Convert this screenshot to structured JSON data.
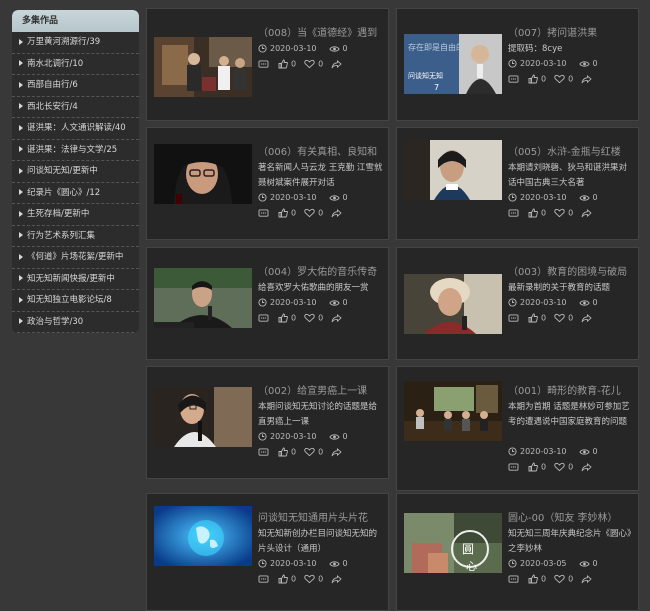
{
  "sidebar": {
    "title": "多集作品",
    "items": [
      "万里黄河溯源行/39",
      "南水北调行/10",
      "西部自由行/6",
      "西北长安行/4",
      "谌洪果：人文通识解读/40",
      "谌洪果：法律与文学/25",
      "问谈知无知/更新中",
      "纪录片《圆心》/12",
      "生死存档/更新中",
      "行为艺术系列汇集",
      "《何道》片场花絮/更新中",
      "知无知新闻快报/更新中",
      "知无知独立电影论坛/8",
      "政治与哲学/30"
    ]
  },
  "cards": [
    {
      "title": "（008）当《道德经》遇到",
      "desc": "",
      "date": "2020-03-10",
      "views": "0",
      "likes": "0",
      "favs": "0",
      "thumb": "thumb-bookstore"
    },
    {
      "title": "（007）拷问谌洪果",
      "desc": "提取码：8cye",
      "date": "2020-03-10",
      "views": "0",
      "likes": "0",
      "favs": "0",
      "thumb": "thumb-portrait-blue",
      "thumb_text1": "存在即是自由的",
      "thumb_text2": "问谈知无知",
      "thumb_text3": "7"
    },
    {
      "title": "（006）有关真相、良知和",
      "desc": "著名新闻人马云龙 王克勤 江雪就聂树斌案件展开对话",
      "date": "2020-03-10",
      "views": "0",
      "likes": "0",
      "favs": "0",
      "thumb": "thumb-woman-glasses"
    },
    {
      "title": "（005）水浒-金瓶与红楼",
      "desc": "本期请刘晓磬、狄马和谌洪果对话中国古典三大名著",
      "date": "2020-03-10",
      "views": "0",
      "likes": "0",
      "favs": "0",
      "thumb": "thumb-woman-short"
    },
    {
      "title": "（004）罗大佑的音乐传奇",
      "desc": "给喜欢罗大佑歌曲的朋友一赏",
      "date": "2020-03-10",
      "views": "0",
      "likes": "0",
      "favs": "0",
      "thumb": "thumb-man-mic"
    },
    {
      "title": "（003）教育的困境与破局",
      "desc": "最新录制的关于教育的话题",
      "date": "2020-03-10",
      "views": "0",
      "likes": "0",
      "favs": "0",
      "thumb": "thumb-woman-hat"
    },
    {
      "title": "（002）给宣男癌上一课",
      "desc": "本期问谈知无知讨论的话题是给直男癌上一课",
      "date": "2020-03-10",
      "views": "0",
      "likes": "0",
      "favs": "0",
      "thumb": "thumb-woman-mic"
    },
    {
      "title": "（001）畸形的教育-花儿",
      "desc": "本期为首期 话题是林妙可参加艺考的遭遇说中国家庭教育的问题",
      "date": "2020-03-10",
      "views": "0",
      "likes": "0",
      "favs": "0",
      "thumb": "thumb-panel"
    },
    {
      "title": "问谈知无知通用片头片花",
      "desc": "知无知新创办栏目问谈知无知的片头设计（通用）",
      "date": "2020-03-10",
      "views": "0",
      "likes": "0",
      "favs": "0",
      "thumb": "thumb-globe"
    },
    {
      "title": "圆心-00（知友 李妙林）",
      "desc": "知无知三周年庆典纪念片《圆心》之李妙林",
      "date": "2020-03-05",
      "views": "0",
      "likes": "0",
      "favs": "0",
      "thumb": "thumb-yuanxin",
      "thumb_text1": "圓",
      "thumb_text2": "心"
    }
  ]
}
